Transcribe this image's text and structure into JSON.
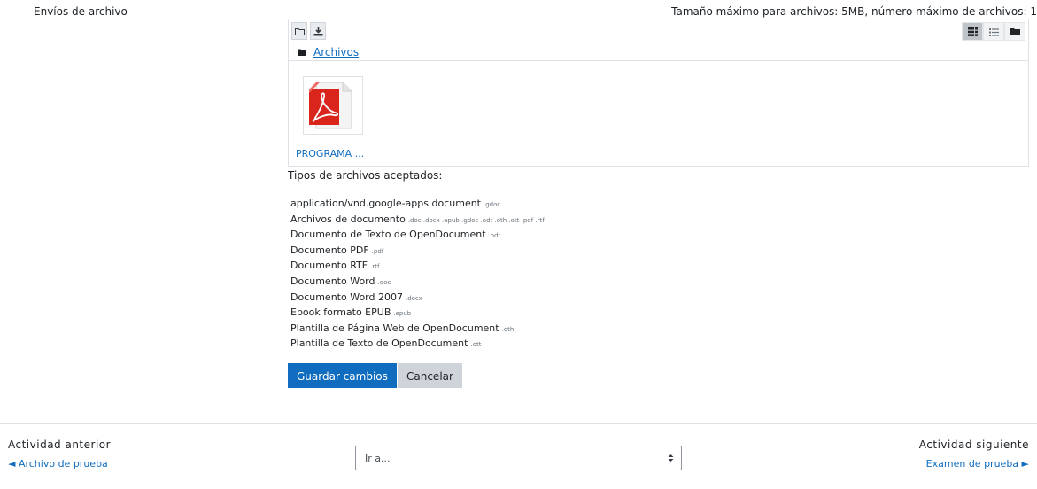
{
  "field_label": "Envíos de archivo",
  "max_info": "Tamaño máximo para archivos: 5MB, número máximo de archivos: 1",
  "filemanager": {
    "path_folder": "Archivos",
    "file_name": "PROGRAMA ...",
    "toolbar_icons": [
      "folder-icon",
      "download-icon"
    ],
    "view_icons": [
      "grid-view-icon",
      "list-view-icon",
      "tree-view-icon"
    ]
  },
  "accepted_title": "Tipos de archivos aceptados:",
  "accepted_types": [
    {
      "name": "application/vnd.google-apps.document",
      "ext": ".gdoc"
    },
    {
      "name": "Archivos de documento",
      "ext": ".doc .docx .epub .gdoc .odt .oth .ott .pdf .rtf"
    },
    {
      "name": "Documento de Texto de OpenDocument",
      "ext": ".odt"
    },
    {
      "name": "Documento PDF",
      "ext": ".pdf"
    },
    {
      "name": "Documento RTF",
      "ext": ".rtf"
    },
    {
      "name": "Documento Word",
      "ext": ".doc"
    },
    {
      "name": "Documento Word 2007",
      "ext": ".docx"
    },
    {
      "name": "Ebook formato EPUB",
      "ext": ".epub"
    },
    {
      "name": "Plantilla de Página Web de OpenDocument",
      "ext": ".oth"
    },
    {
      "name": "Plantilla de Texto de OpenDocument",
      "ext": ".ott"
    }
  ],
  "buttons": {
    "save": "Guardar cambios",
    "cancel": "Cancelar"
  },
  "nav": {
    "prev_label": "Actividad anterior",
    "prev_link": "◄ Archivo de prueba",
    "jump_placeholder": "Ir a...",
    "next_label": "Actividad siguiente",
    "next_link": "Examen de prueba ►"
  }
}
